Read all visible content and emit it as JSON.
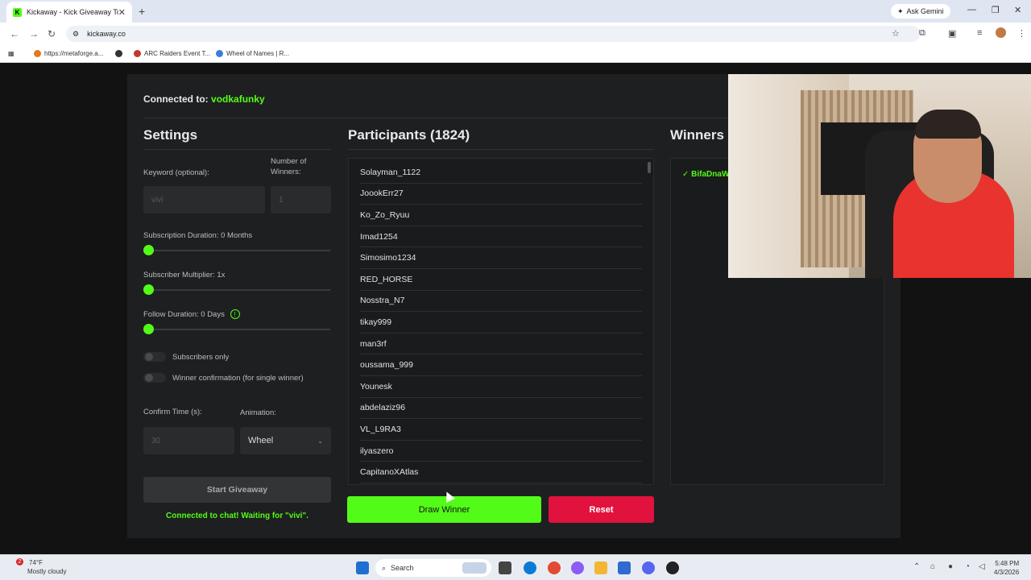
{
  "browser": {
    "tab_title": "Kickaway - Kick Giveaway Tool",
    "url": "kickaway.co",
    "gemini_label": "Ask Gemini",
    "bookmarks": [
      {
        "label": "https://metaforge.a...",
        "color": "#e07a1c"
      },
      {
        "label": "",
        "color": "#333333"
      },
      {
        "label": "ARC Raiders Event T...",
        "color": "#c0392b"
      },
      {
        "label": "Wheel of Names | R...",
        "color": "#3b7ddd"
      }
    ]
  },
  "page": {
    "connected_label": "Connected to:",
    "connected_user": "vodkafunky",
    "settings": {
      "title": "Settings",
      "keyword_label": "Keyword (optional):",
      "keyword_value": "vivi",
      "winners_label": "Number of Winners:",
      "winners_value": "1",
      "sub_duration_label": "Subscription Duration: 0 Months",
      "sub_multiplier_label": "Subscriber Multiplier: 1x",
      "follow_duration_label": "Follow Duration:  0  Days",
      "subscribers_only_label": "Subscribers only",
      "winner_confirmation_label": "Winner confirmation (for single winner)",
      "confirm_time_label": "Confirm Time (s):",
      "confirm_time_value": "30",
      "animation_label": "Animation:",
      "animation_value": "Wheel",
      "start_button": "Start Giveaway",
      "status": "Connected to chat! Waiting for \"vivi\"."
    },
    "participants": {
      "title": "Participants (1824)",
      "list": [
        "Solayman_1122",
        "JoookErr27",
        "Ko_Zo_Ryuu",
        "Imad1254",
        "Simosimo1234",
        "RED_HORSE",
        "Nosstra_N7",
        "tikay999",
        "man3rf",
        "oussama_999",
        "Younesk",
        "abdelaziz96",
        "VL_L9RA3",
        "ilyaszero",
        "CapitanoXAtlas"
      ],
      "draw_button": "Draw Winner",
      "reset_button": "Reset"
    },
    "winners": {
      "title": "Winners",
      "list": [
        "✓ BifaDnaW"
      ]
    }
  },
  "taskbar": {
    "weather_temp": "74°F",
    "weather_desc": "Mostly cloudy",
    "notification_count": "2",
    "search_placeholder": "Search",
    "time": "5:48 PM",
    "date": "4/3/2026"
  },
  "colors": {
    "accent": "#53fc18",
    "danger": "#e1123d",
    "card": "#1e1f20"
  }
}
